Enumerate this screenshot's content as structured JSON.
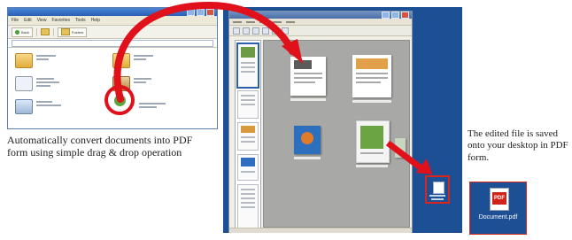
{
  "captions": {
    "left": "Automatically convert documents into PDF form using simple drag & drop operation",
    "right": "The edited file is saved onto your desktop in PDF form."
  },
  "explorer": {
    "title": "",
    "menu": [
      "File",
      "Edit",
      "View",
      "Favorites",
      "Tools",
      "Help"
    ],
    "toolbar": {
      "back_label": "Back",
      "folders_label": "Folders"
    },
    "items": [
      "folder",
      "folder",
      "document",
      "music",
      "spreadsheet",
      "document"
    ]
  },
  "desktop": {
    "result_file_name": "Document.pdf",
    "pdf_label": "PDF"
  },
  "colors": {
    "accent_red": "#e0111a",
    "desktop_blue": "#1c4f93",
    "canvas_gray": "#a8a9a6"
  }
}
